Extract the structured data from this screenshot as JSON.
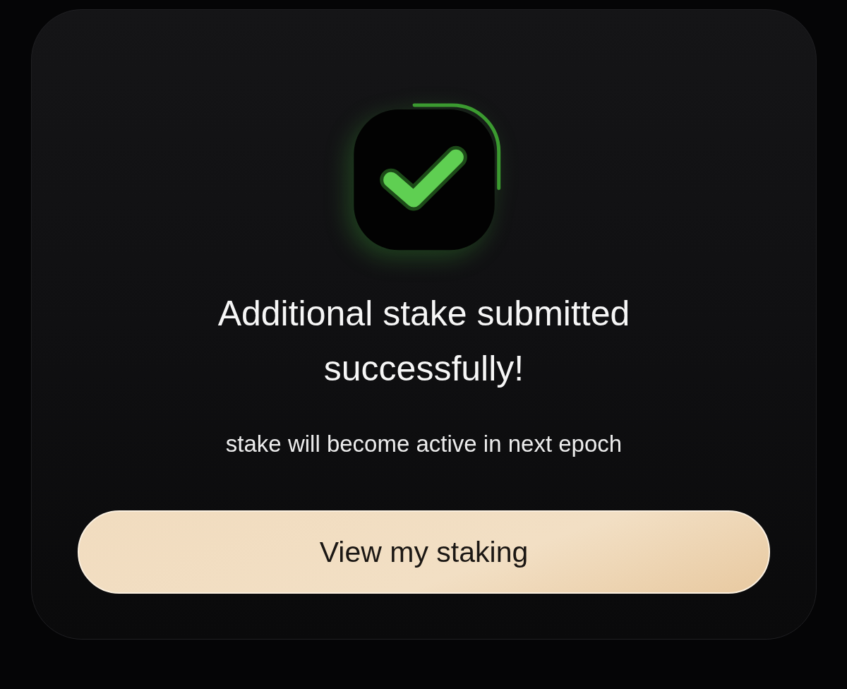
{
  "dialog": {
    "title": "Additional stake submitted successfully!",
    "message": "stake will become active in next epoch",
    "button": "View my staking"
  }
}
